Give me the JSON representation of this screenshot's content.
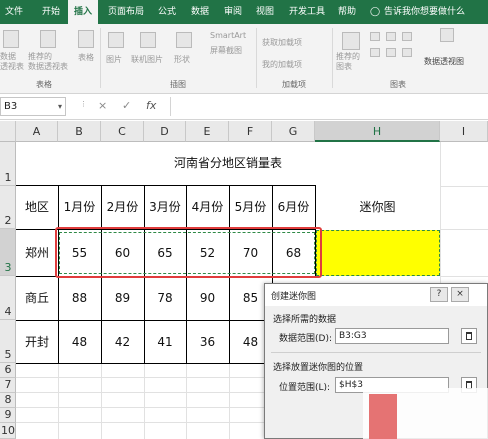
{
  "ribbon_tabs": [
    "文件",
    "开始",
    "插入",
    "页面布局",
    "公式",
    "数据",
    "审阅",
    "视图",
    "开发工具",
    "帮助"
  ],
  "active_tab_index": 2,
  "tell_me": "告诉我你想要做什么",
  "ribbon": {
    "groups": [
      "表格",
      "插图",
      "加载项",
      "图表"
    ],
    "items": {
      "pivot_short": "数据\n透视表",
      "recommended_pivot": "推荐的\n数据透视表",
      "table": "表格",
      "pictures": "图片",
      "online_pictures": "联机图片",
      "shapes": "形状",
      "smartart": "SmartArt",
      "screenshot": "屏幕截图",
      "get_addins": "获取加载项",
      "my_addins": "我的加载项",
      "recommended_charts": "推荐的\n图表",
      "pivot_chart": "数据透视图"
    }
  },
  "formula_bar": {
    "name_box": "B3",
    "cancel": "×",
    "enter": "✓",
    "fx": "fx",
    "formula": ""
  },
  "columns": [
    "A",
    "B",
    "C",
    "D",
    "E",
    "F",
    "G",
    "H",
    "I"
  ],
  "selected_column": "H",
  "rows": [
    "1",
    "2",
    "3",
    "4",
    "5",
    "6",
    "7",
    "8",
    "9",
    "10"
  ],
  "selected_row": "3",
  "sheet": {
    "title": "河南省分地区销量表",
    "header_area": "地区",
    "months": [
      "1月份",
      "2月份",
      "3月份",
      "4月份",
      "5月份",
      "6月份"
    ],
    "sparkline_header": "迷你图",
    "data": [
      {
        "region": "郑州",
        "values": [
          "55",
          "60",
          "65",
          "52",
          "70",
          "68"
        ]
      },
      {
        "region": "商丘",
        "values": [
          "88",
          "89",
          "78",
          "90",
          "85",
          ""
        ]
      },
      {
        "region": "开封",
        "values": [
          "48",
          "42",
          "41",
          "36",
          "48",
          ""
        ]
      }
    ],
    "highlight_color": "#ffff00"
  },
  "dialog": {
    "title": "创建迷你图",
    "help": "?",
    "close": "×",
    "section_data": "选择所需的数据",
    "data_range_label": "数据范围(D):",
    "data_range_value": "B3:G3",
    "section_location": "选择放置迷你图的位置",
    "location_range_label": "位置范围(L):",
    "location_range_value": "$H$3"
  },
  "colors": {
    "excel_green": "#217346",
    "selection_red": "#e03c3c",
    "marching_ants": "#2f8a47"
  }
}
